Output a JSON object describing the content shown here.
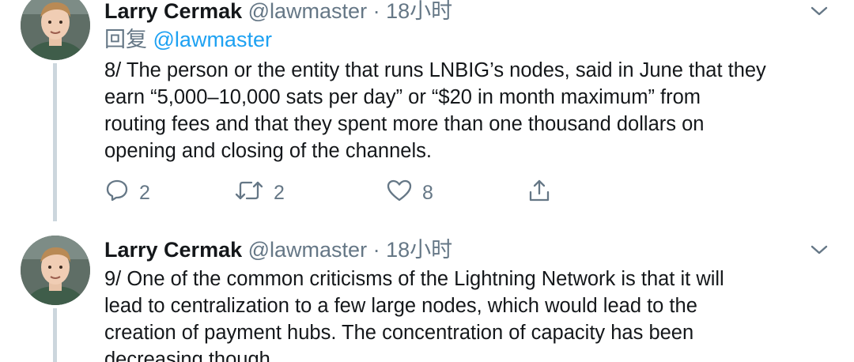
{
  "tweets": [
    {
      "author_name": "Larry Cermak",
      "handle": "@lawmaster",
      "separator": "·",
      "time": "18小时",
      "reply_prefix": "回复",
      "reply_to": "@lawmaster",
      "text": "8/ The person or the entity that runs LNBIG’s nodes, said in June that they\nearn “5,000–10,000 sats per day” or “$20 in month maximum” from\nrouting fees and that they spent more than one thousand dollars on\nopening and closing of the channels.",
      "reply_count": "2",
      "retweet_count": "2",
      "like_count": "8"
    },
    {
      "author_name": "Larry Cermak",
      "handle": "@lawmaster",
      "separator": "·",
      "time": "18小时",
      "text": "9/ One of the common criticisms of the Lightning Network is that it will\nlead to centralization to a few large nodes, which would lead to the\ncreation of payment hubs. The concentration of capacity has been\ndecreasing though."
    }
  ],
  "icons": {
    "reply": "speech-bubble-icon",
    "retweet": "retweet-arrows-icon",
    "like": "heart-outline-icon",
    "share": "share-upload-icon",
    "more": "chevron-down-icon"
  },
  "colors": {
    "text": "#14171a",
    "secondary": "#657786",
    "link": "#1da1f2",
    "thread_line": "#ccd6dd",
    "background": "#ffffff"
  }
}
